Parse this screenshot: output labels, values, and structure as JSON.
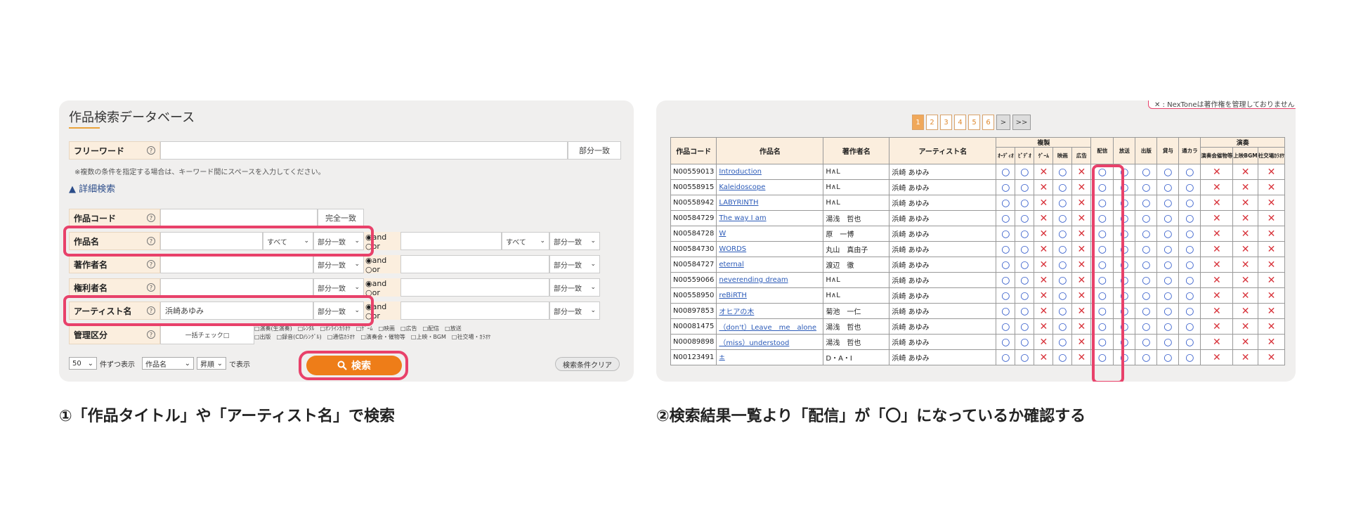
{
  "search_form": {
    "title": "作品検索データベース",
    "free_word": {
      "label": "フリーワード",
      "match": "部分一致",
      "value": ""
    },
    "note": "※複数の条件を指定する場合は、キーワード間にスペースを入力してください。",
    "detail_toggle": "▲ 詳細検索",
    "work_code": {
      "label": "作品コード",
      "match": "完全一致"
    },
    "work_name": {
      "label": "作品名",
      "scope": "すべて",
      "match": "部分一致",
      "value": ""
    },
    "author": {
      "label": "著作者名",
      "match": "部分一致"
    },
    "rights_holder": {
      "label": "権利者名",
      "match": "部分一致"
    },
    "artist": {
      "label": "アーティスト名",
      "match": "部分一致",
      "value": "浜崎あゆみ"
    },
    "and_or": {
      "and": "◉and",
      "or": "○or"
    },
    "right_scope": "すべて",
    "right_match": "部分一致",
    "management": {
      "label": "管理区分",
      "check_all": "一括チェック□",
      "row1": "□演奏(生演奏)　□ﾚﾝﾀﾙ　□ｵﾝﾗｲﾝｶﾗｵｹ　□ｹﾞｰﾑ　□映画　□広告　□配信　□放送",
      "row2": "□出版　□録音(CD/ｼﾝｸﾞﾙ)　□通信ｶﾗｵｹ　□演奏会・催物等　□上映・BGM　□社交場・ｶﾗｵｹ"
    },
    "per_page": "50",
    "per_page_suffix": "件ずつ表示",
    "sort_field": "作品名",
    "sort_order": "昇順",
    "sort_suffix": "で表示",
    "search_button": "検索",
    "clear_button": "検索条件クリア"
  },
  "results": {
    "warning": "✕ : NexToneは著作権を管理しておりません。",
    "pages": [
      "1",
      "2",
      "3",
      "4",
      "5",
      "6",
      ">",
      ">>"
    ],
    "headers": {
      "code": "作品コード",
      "title": "作品名",
      "author": "著作者名",
      "artist": "アーティスト名",
      "group_copy": "複製",
      "group_perf": "演奏",
      "sub": [
        "ｵｰﾃﾞｨｵ",
        "ﾋﾞﾃﾞｵ",
        "ｹﾞｰﾑ",
        "映画",
        "広告",
        "配信",
        "放送",
        "出版",
        "貸与",
        "通カラ",
        "演奏会催物等",
        "上映BGM",
        "社交場ｶﾗｵｹ"
      ]
    },
    "rows": [
      {
        "code": "N00559013",
        "title": "Introduction",
        "author": "H∧L",
        "artist": "浜崎 あゆみ",
        "marks": [
          "○",
          "○",
          "✕",
          "○",
          "✕",
          "○",
          "○",
          "○",
          "○",
          "○",
          "✕",
          "✕",
          "✕"
        ]
      },
      {
        "code": "N00558915",
        "title": "Kaleidoscope",
        "author": "H∧L",
        "artist": "浜崎 あゆみ",
        "marks": [
          "○",
          "○",
          "✕",
          "○",
          "✕",
          "○",
          "○",
          "○",
          "○",
          "○",
          "✕",
          "✕",
          "✕"
        ]
      },
      {
        "code": "N00558942",
        "title": "LABYRINTH",
        "author": "H∧L",
        "artist": "浜崎 あゆみ",
        "marks": [
          "○",
          "○",
          "✕",
          "○",
          "✕",
          "○",
          "○",
          "○",
          "○",
          "○",
          "✕",
          "✕",
          "✕"
        ]
      },
      {
        "code": "N00584729",
        "title": "The way I am",
        "author": "湯浅　哲也",
        "artist": "浜崎 あゆみ",
        "marks": [
          "○",
          "○",
          "✕",
          "○",
          "✕",
          "○",
          "○",
          "○",
          "○",
          "○",
          "✕",
          "✕",
          "✕"
        ]
      },
      {
        "code": "N00584728",
        "title": "W",
        "author": "原　一博",
        "artist": "浜崎 あゆみ",
        "marks": [
          "○",
          "○",
          "✕",
          "○",
          "✕",
          "○",
          "○",
          "○",
          "○",
          "○",
          "✕",
          "✕",
          "✕"
        ]
      },
      {
        "code": "N00584730",
        "title": "WORDS",
        "author": "丸山　真由子",
        "artist": "浜崎 あゆみ",
        "marks": [
          "○",
          "○",
          "✕",
          "○",
          "✕",
          "○",
          "○",
          "○",
          "○",
          "○",
          "✕",
          "✕",
          "✕"
        ]
      },
      {
        "code": "N00584727",
        "title": "eternal",
        "author": "渡辺　徹",
        "artist": "浜崎 あゆみ",
        "marks": [
          "○",
          "○",
          "✕",
          "○",
          "✕",
          "○",
          "○",
          "○",
          "○",
          "○",
          "✕",
          "✕",
          "✕"
        ]
      },
      {
        "code": "N00559066",
        "title": "neverending dream",
        "author": "H∧L",
        "artist": "浜崎 あゆみ",
        "marks": [
          "○",
          "○",
          "✕",
          "○",
          "✕",
          "○",
          "○",
          "○",
          "○",
          "○",
          "✕",
          "✕",
          "✕"
        ]
      },
      {
        "code": "N00558950",
        "title": "reBiRTH",
        "author": "H∧L",
        "artist": "浜崎 あゆみ",
        "marks": [
          "○",
          "○",
          "✕",
          "○",
          "✕",
          "○",
          "○",
          "○",
          "○",
          "○",
          "✕",
          "✕",
          "✕"
        ]
      },
      {
        "code": "N00897853",
        "title": "オヒアの木",
        "author": "菊池　一仁",
        "artist": "浜崎 あゆみ",
        "marks": [
          "○",
          "○",
          "✕",
          "○",
          "✕",
          "○",
          "○",
          "○",
          "○",
          "○",
          "✕",
          "✕",
          "✕"
        ]
      },
      {
        "code": "N00081475",
        "title": "（don't）Leave　me　alone",
        "author": "湯浅　哲也",
        "artist": "浜崎 あゆみ",
        "marks": [
          "○",
          "○",
          "✕",
          "○",
          "✕",
          "○",
          "○",
          "○",
          "○",
          "○",
          "✕",
          "✕",
          "✕"
        ]
      },
      {
        "code": "N00089898",
        "title": "（miss）understood",
        "author": "湯浅　哲也",
        "artist": "浜崎 あゆみ",
        "marks": [
          "○",
          "○",
          "✕",
          "○",
          "✕",
          "○",
          "○",
          "○",
          "○",
          "○",
          "✕",
          "✕",
          "✕"
        ]
      },
      {
        "code": "N00123491",
        "title": "±",
        "author": "D・A・I",
        "artist": "浜崎 あゆみ",
        "marks": [
          "○",
          "○",
          "✕",
          "○",
          "✕",
          "○",
          "○",
          "○",
          "○",
          "○",
          "✕",
          "✕",
          "✕"
        ]
      }
    ]
  },
  "captions": {
    "step1": "①「作品タイトル」や「アーティスト名」で検索",
    "step2": "②検索結果一覧より「配信」が「〇」になっているか確認する"
  }
}
